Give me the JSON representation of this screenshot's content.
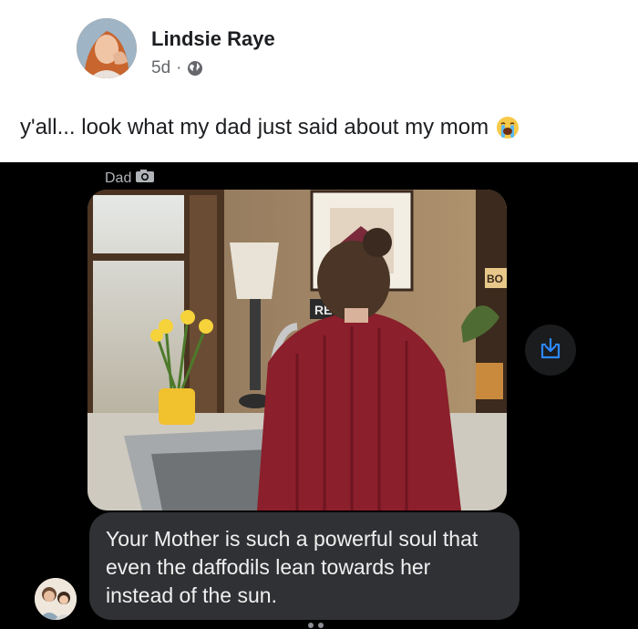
{
  "post": {
    "author": "Lindsie Raye",
    "time": "5d",
    "separator": "·",
    "audience_icon": "globe-icon",
    "caption": "y'all... look what my dad just said about my mom",
    "caption_emoji": "loudly-crying-face"
  },
  "message": {
    "sender": "Dad",
    "sender_icon": "camera-icon",
    "photo_visible_text": {
      "sign": "RE",
      "book": "BO"
    },
    "text": "Your Mother is such a powerful soul that even the daffodils lean towards her instead of the sun.",
    "save_icon": "download-icon"
  },
  "colors": {
    "link_blue": "#2d88ff",
    "bubble": "#303134",
    "sweater": "#8b1f2b"
  }
}
